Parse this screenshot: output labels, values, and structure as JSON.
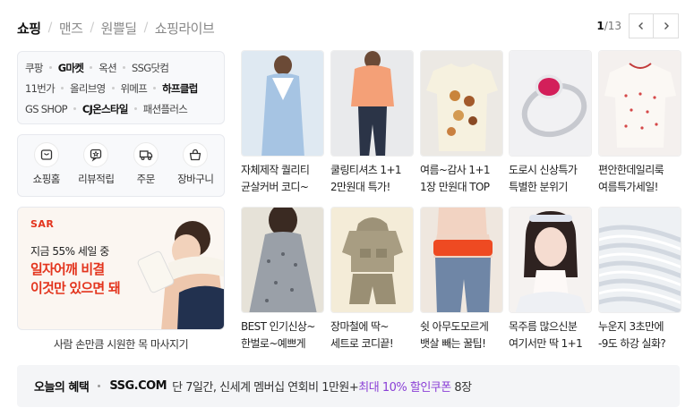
{
  "tabs": [
    {
      "label": "쇼핑",
      "active": true
    },
    {
      "label": "맨즈",
      "active": false
    },
    {
      "label": "원쁠딜",
      "active": false
    },
    {
      "label": "쇼핑라이브",
      "active": false
    }
  ],
  "pager": {
    "current": "1",
    "total": "/13",
    "prev_icon": "chevron-left-icon",
    "next_icon": "chevron-right-icon"
  },
  "malls": {
    "row1": [
      "쿠팡",
      "G마켓",
      "옥션",
      "SSG닷컴"
    ],
    "row2": [
      "11번가",
      "올리브영",
      "위메프",
      "하프클럽"
    ],
    "row3": [
      "GS SHOP",
      "CJ온스타일",
      "패션플러스"
    ],
    "bold": [
      "G마켓",
      "하프클럽",
      "CJ온스타일"
    ]
  },
  "quick_menu": [
    {
      "label": "쇼핑홈",
      "icon": "shopping-home-icon"
    },
    {
      "label": "리뷰적립",
      "icon": "review-star-icon"
    },
    {
      "label": "주문",
      "icon": "delivery-truck-icon"
    },
    {
      "label": "장바구니",
      "icon": "shopping-bag-icon"
    }
  ],
  "ad": {
    "logo": "SAR",
    "sub": "지금 55% 세일 중",
    "title_line1": "일자어깨 비결",
    "title_line2": "이것만 있으면 돼",
    "caption": "사람 손만큼 시원한 목 마사지기"
  },
  "products": [
    {
      "line1": "자체제작 퀄리티",
      "line2": "균살커버 코디~"
    },
    {
      "line1": "쿨링티셔츠 1+1",
      "line2": "2만원대 특가!"
    },
    {
      "line1": "여름~감사 1+1",
      "line2": "1장 만원대 TOP"
    },
    {
      "line1": "도로시 신상특가",
      "line2": "특별한 분위기"
    },
    {
      "line1": "편안한데일리룩",
      "line2": "여름특가세일!"
    },
    {
      "line1": "BEST 인기신상~",
      "line2": "한벌로~예쁘게"
    },
    {
      "line1": "장마철에 딱~",
      "line2": "세트로 코디끝!"
    },
    {
      "line1": "쉿 아무도모르게",
      "line2": "뱃살 빼는 꿀팁!"
    },
    {
      "line1": "목주름 많으신분",
      "line2": "여기서만 딱 1+1"
    },
    {
      "line1": "누운지 3초만에",
      "line2": "-9도 하강 실화?"
    }
  ],
  "benefit": {
    "label": "오늘의 혜택",
    "brand": "SSG.COM",
    "text": "단 7일간, 신세계 멤버십 연회비 1만원+",
    "highlight": "최대 10% 할인쿠폰",
    "suffix": " 8장"
  },
  "colors": {
    "accent_red": "#e3341d",
    "accent_purple": "#8a3fd6"
  }
}
